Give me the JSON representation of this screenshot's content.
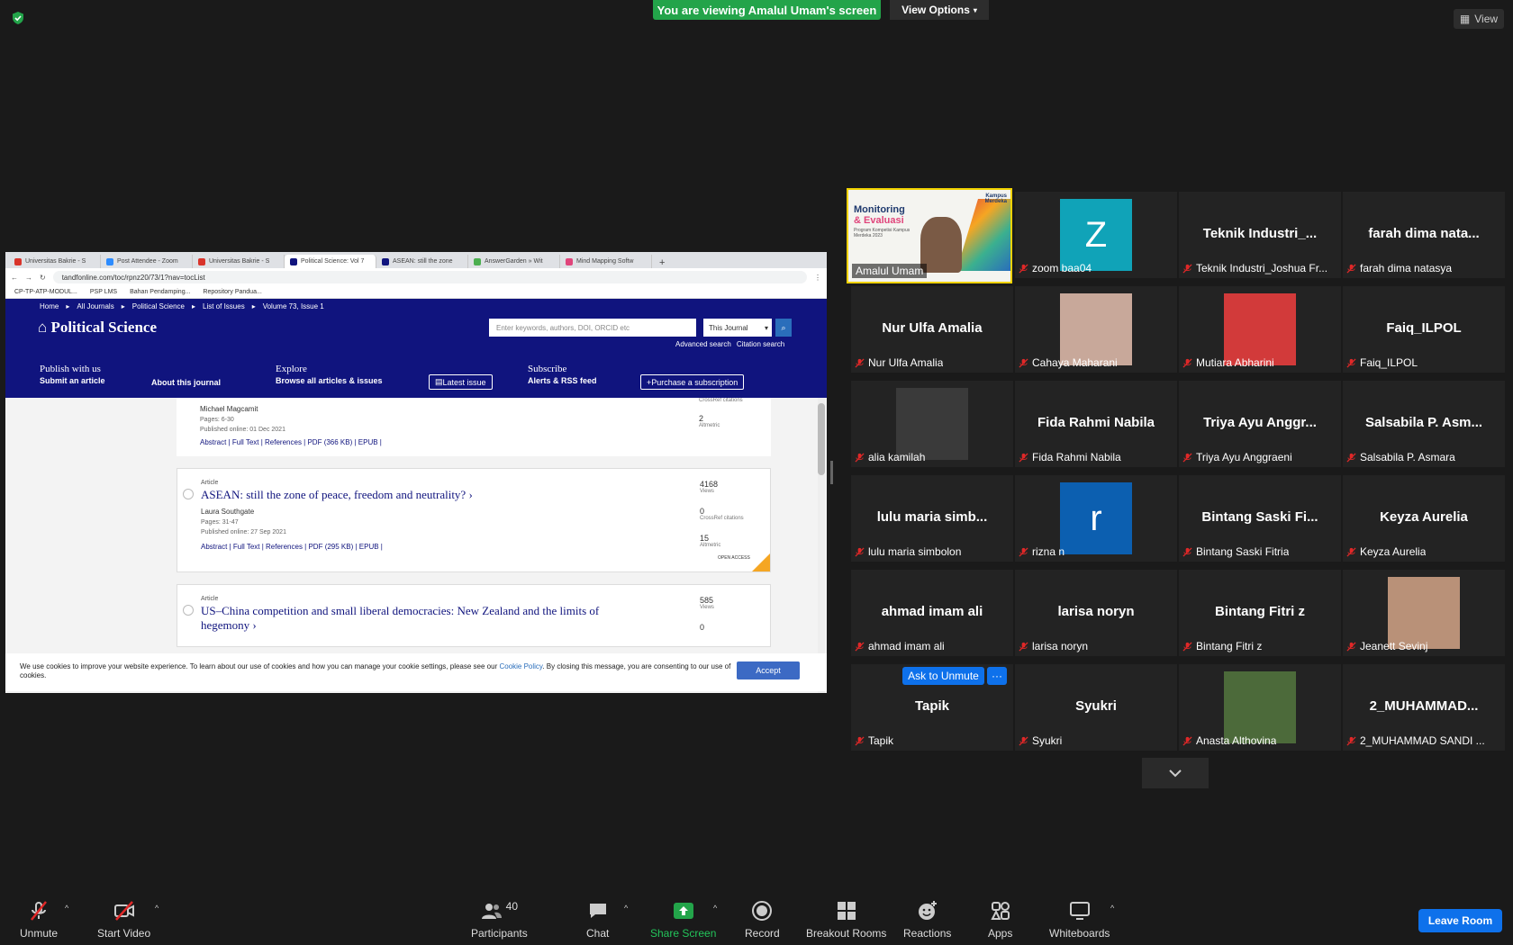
{
  "zoom": {
    "banner": "You are viewing Amalul Umam's screen",
    "view_options": "View Options",
    "view_label": "View",
    "brand_green": "#23a44a",
    "accent_blue": "#0e71eb"
  },
  "browser": {
    "tabs": [
      {
        "title": "Universitas Bakrie - S",
        "color": "#d9342b"
      },
      {
        "title": "Post Attendee - Zoom",
        "color": "#2d8cff"
      },
      {
        "title": "Universitas Bakrie - S",
        "color": "#d9342b"
      },
      {
        "title": "Political Science: Vol 7",
        "color": "#10147e"
      },
      {
        "title": "ASEAN: still the zone",
        "color": "#10147e"
      },
      {
        "title": "AnswerGarden » Wit",
        "color": "#4caf50"
      },
      {
        "title": "Mind Mapping Softw",
        "color": "#e0457b"
      }
    ],
    "url": "tandfonline.com/toc/rpnz20/73/1?nav=tocList",
    "bookmarks": [
      "CP-TP-ATP-MODUL...",
      "PSP LMS",
      "Bahan Pendamping...",
      "Repository Pandua..."
    ]
  },
  "site": {
    "breadcrumb": [
      "Home",
      "All Journals",
      "Political Science",
      "List of Issues",
      "Volume 73, Issue 1"
    ],
    "journal_title": "Political Science",
    "search_placeholder": "Enter keywords, authors, DOI, ORCID etc",
    "search_scope": "This Journal",
    "advanced_search": "Advanced search",
    "citation_search": "Citation search",
    "nav": {
      "publish": "Publish with us",
      "submit": "Submit an article",
      "about": "About this journal",
      "explore": "Explore",
      "browse": "Browse all articles & issues",
      "latest": "Latest issue",
      "subscribe": "Subscribe",
      "alerts": "Alerts & RSS feed",
      "purchase": "Purchase a subscription"
    }
  },
  "articles": [
    {
      "author": "Michael Magcamit",
      "pages": "Pages: 6-30",
      "published": "Published online: 01 Dec 2021",
      "links": "Abstract | Full Text | References | PDF (366 KB) | EPUB |",
      "crossref_label": "CrossRef citations",
      "altmetric": "2",
      "altmetric_label": "Altmetric"
    },
    {
      "type": "Article",
      "title": "ASEAN: still the zone of peace, freedom and neutrality?",
      "author": "Laura Southgate",
      "pages": "Pages: 31-47",
      "published": "Published online: 27 Sep 2021",
      "links": "Abstract | Full Text | References | PDF (295 KB) | EPUB |",
      "views": "4168",
      "views_label": "Views",
      "crossref": "0",
      "crossref_label": "CrossRef citations",
      "altmetric": "15",
      "altmetric_label": "Altmetric",
      "open_access": "OPEN ACCESS"
    },
    {
      "type": "Article",
      "title": "US–China competition and small liberal democracies: New Zealand and the limits of hegemony",
      "views": "585",
      "views_label": "Views",
      "crossref": "0"
    }
  ],
  "cookie": {
    "text_before": "We use cookies to improve your website experience. To learn about our use of cookies and how you can manage your cookie settings, please see our ",
    "policy_link": "Cookie Policy",
    "text_after": ". By closing this message, you are consenting to our use of cookies.",
    "accept": "Accept"
  },
  "gallery": {
    "active_speaker": "Amalul Umam",
    "active_slide": {
      "line1": "Monitoring",
      "line2": "& Evaluasi",
      "small": "Program Kompetisi Kampus Merdeka 2023",
      "badge": "Kampus Merdeka"
    },
    "participants": [
      {
        "display": "Z",
        "label": "zoom baa04",
        "kind": "avatar",
        "bg": "#10a3b8"
      },
      {
        "display": "Teknik  Industri_...",
        "label": "Teknik Industri_Joshua Fr...",
        "kind": "name"
      },
      {
        "display": "farah dima nata...",
        "label": "farah dima natasya",
        "kind": "name"
      },
      {
        "display": "Nur Ulfa Amalia",
        "label": "Nur Ulfa Amalia",
        "kind": "name"
      },
      {
        "display": "",
        "label": "Cahaya Maharani",
        "kind": "photo",
        "bg": "#c8a89a"
      },
      {
        "display": "",
        "label": "Mutiara Abharini",
        "kind": "photo",
        "bg": "#d23a3a"
      },
      {
        "display": "Faiq_ILPOL",
        "label": "Faiq_ILPOL",
        "kind": "name"
      },
      {
        "display": "",
        "label": "alia kamilah",
        "kind": "photo",
        "bg": "#3a3a3a"
      },
      {
        "display": "Fida Rahmi Nabila",
        "label": "Fida Rahmi Nabila",
        "kind": "name"
      },
      {
        "display": "Triya Ayu Anggr...",
        "label": "Triya Ayu Anggraeni",
        "kind": "name"
      },
      {
        "display": "Salsabila P. Asm...",
        "label": "Salsabila P. Asmara",
        "kind": "name"
      },
      {
        "display": "lulu maria simb...",
        "label": "lulu maria simbolon",
        "kind": "name"
      },
      {
        "display": "r",
        "label": "rizna n",
        "kind": "avatar",
        "bg": "#0c5fb0"
      },
      {
        "display": "Bintang Saski Fi...",
        "label": "Bintang Saski Fitria",
        "kind": "name"
      },
      {
        "display": "Keyza Aurelia",
        "label": "Keyza Aurelia",
        "kind": "name"
      },
      {
        "display": "ahmad imam ali",
        "label": "ahmad imam ali",
        "kind": "name"
      },
      {
        "display": "larisa noryn",
        "label": "larisa noryn",
        "kind": "name"
      },
      {
        "display": "Bintang Fitri z",
        "label": "Bintang Fitri z",
        "kind": "name"
      },
      {
        "display": "",
        "label": "Jeanett Sevinj",
        "kind": "photo",
        "bg": "#b99178"
      },
      {
        "display": "Tapik",
        "label": "Tapik",
        "kind": "name"
      },
      {
        "display": "Syukri",
        "label": "Syukri",
        "kind": "name"
      },
      {
        "display": "",
        "label": "Anasta Althovina",
        "kind": "photo",
        "bg": "#4c6a3a"
      },
      {
        "display": "2_MUHAMMAD...",
        "label": "2_MUHAMMAD SANDI ...",
        "kind": "name"
      }
    ],
    "ask_to_unmute": "Ask to Unmute",
    "more": "···"
  },
  "toolbar": {
    "unmute": "Unmute",
    "start_video": "Start Video",
    "participants": "Participants",
    "participants_count": "40",
    "chat": "Chat",
    "share_screen": "Share Screen",
    "record": "Record",
    "breakout": "Breakout Rooms",
    "reactions": "Reactions",
    "apps": "Apps",
    "whiteboards": "Whiteboards",
    "leave": "Leave Room"
  }
}
